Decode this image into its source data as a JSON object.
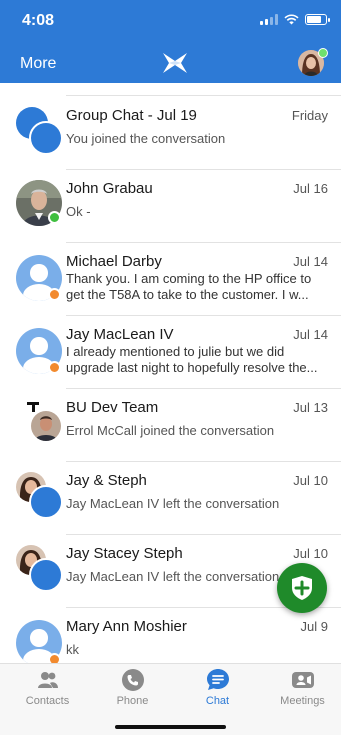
{
  "status_bar": {
    "time": "4:08"
  },
  "header": {
    "more_label": "More"
  },
  "conversations": [
    {
      "name": "Group Chat - Jul 19",
      "date": "Friday",
      "preview": "You joined the conversation"
    },
    {
      "name": "John Grabau",
      "date": "Jul 16",
      "preview": "Ok -"
    },
    {
      "name": "Michael Darby",
      "date": "Jul 14",
      "preview": "Thank you.  I am coming to the HP office to get the T58A to take to the customer.   I w..."
    },
    {
      "name": "Jay MacLean IV",
      "date": "Jul 14",
      "preview": "I already mentioned to julie but we did upgrade last night to hopefully resolve the..."
    },
    {
      "name": "BU Dev Team",
      "date": "Jul 13",
      "preview": "Errol McCall joined the conversation"
    },
    {
      "name": "Jay & Steph",
      "date": "Jul 10",
      "preview": "Jay MacLean IV left the conversation"
    },
    {
      "name": "Jay Stacey Steph",
      "date": "Jul 10",
      "preview": "Jay MacLean IV left the conversation"
    },
    {
      "name": "Mary Ann Moshier",
      "date": "Jul 9",
      "preview": "kk"
    }
  ],
  "tabs": [
    {
      "label": "Contacts",
      "icon": "contacts-icon"
    },
    {
      "label": "Phone",
      "icon": "phone-icon"
    },
    {
      "label": "Chat",
      "icon": "chat-icon",
      "active": true
    },
    {
      "label": "Meetings",
      "icon": "meetings-icon"
    }
  ],
  "colors": {
    "brand": "#2d7ad6",
    "fab": "#1f8a2a",
    "presence_online": "#3fbf3f",
    "presence_away": "#f28a2e"
  }
}
